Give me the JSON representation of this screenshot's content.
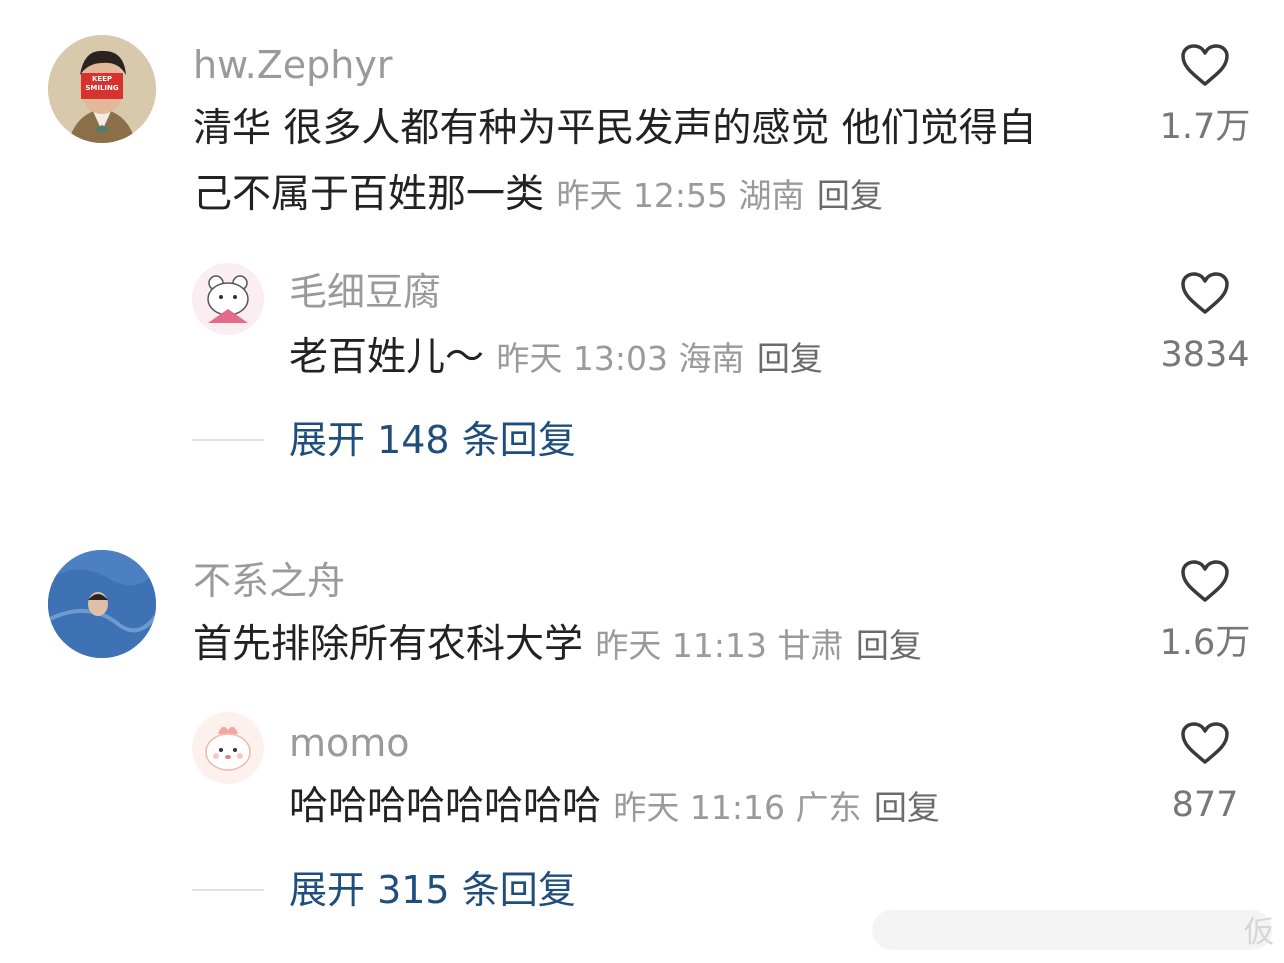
{
  "comments": [
    {
      "username": "hw.Zephyr",
      "text_line1": "清华 很多人都有种为平民发声的感觉 他们觉得自",
      "text_line2": "己不属于百姓那一类",
      "meta": "昨天 12:55 湖南",
      "reply": "回复",
      "likes": "1.7万",
      "avatar_text": "KEEP SMILING",
      "replies": [
        {
          "username": "毛细豆腐",
          "text": "老百姓儿～",
          "meta": "昨天 13:03 海南",
          "reply": "回复",
          "likes": "3834"
        }
      ],
      "expand_label": "展开 148 条回复"
    },
    {
      "username": "不系之舟",
      "text": "首先排除所有农科大学",
      "meta": "昨天 11:13 甘肃",
      "reply": "回复",
      "likes": "1.6万",
      "replies": [
        {
          "username": "momo",
          "text": "哈哈哈哈哈哈哈哈",
          "meta": "昨天 11:16 广东",
          "reply": "回复",
          "likes": "877"
        }
      ],
      "expand_label": "展开 315 条回复"
    }
  ],
  "icons": {
    "like": "heart-outline-icon",
    "avatar_placeholder": "avatar-image"
  },
  "colors": {
    "username": "#9a9a9a",
    "text": "#222222",
    "expand_link": "#1f4e7d",
    "heart_stroke": "#3a3a3a"
  },
  "watermark": "仮"
}
